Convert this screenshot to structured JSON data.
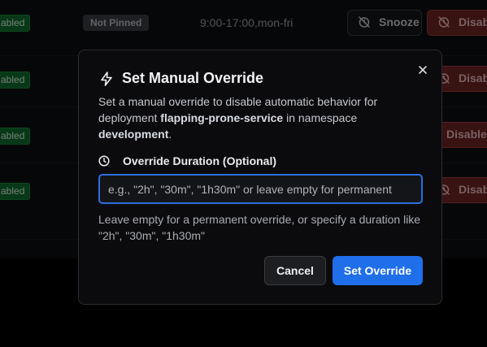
{
  "background": {
    "rows": [
      {
        "status": "abled",
        "pin": "Not Pinned",
        "schedule": "9:00-17:00,mon-fri",
        "snooze_label": "Snooze",
        "disable_label": "Disable"
      },
      {
        "status": "abled",
        "disable_label": "Disable"
      },
      {
        "status": "abled",
        "disable_label": "Disable"
      },
      {
        "status": "abled",
        "disable_label": "Disable"
      }
    ]
  },
  "modal": {
    "title": "Set Manual Override",
    "description_prefix": "Set a manual override to disable automatic behavior for deployment ",
    "deployment": "flapping-prone-service",
    "description_mid": " in namespace ",
    "namespace": "development",
    "description_suffix": ".",
    "duration_label": "Override Duration (Optional)",
    "duration_input": {
      "value": "",
      "placeholder": "e.g., \"2h\", \"30m\", \"1h30m\" or leave empty for permanent"
    },
    "help_text": "Leave empty for a permanent override, or specify a duration like \"2h\", \"30m\", \"1h30m\"",
    "cancel_label": "Cancel",
    "submit_label": "Set Override"
  },
  "icons": {
    "title": "lightning-icon",
    "duration": "clock-icon",
    "close": "close-icon",
    "snooze": "snooze-off-icon",
    "disable": "snooze-off-icon"
  },
  "colors": {
    "primary": "#1f6fea",
    "status_green": "#0e6b2c",
    "danger": "#6e2424"
  }
}
